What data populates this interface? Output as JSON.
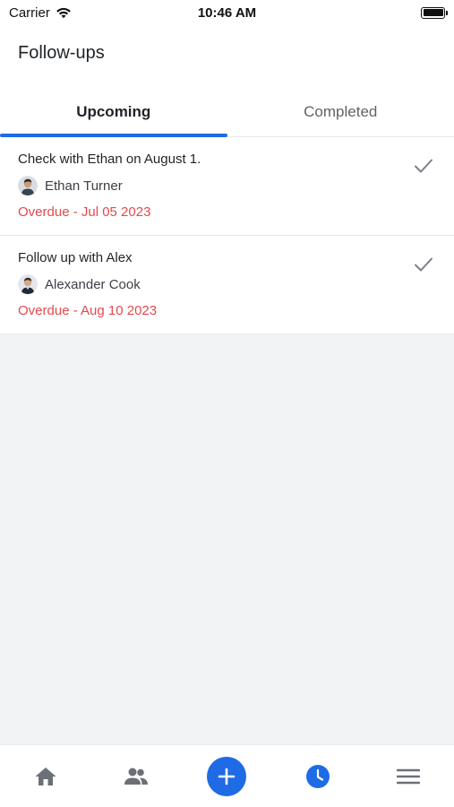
{
  "status_bar": {
    "carrier": "Carrier",
    "time": "10:46 AM"
  },
  "header": {
    "title": "Follow-ups"
  },
  "tabs": [
    {
      "label": "Upcoming",
      "active": true
    },
    {
      "label": "Completed",
      "active": false
    }
  ],
  "followups": [
    {
      "title": "Check with Ethan on August 1.",
      "person": "Ethan Turner",
      "due": "Overdue - Jul 05 2023",
      "icon": "checkmark-icon"
    },
    {
      "title": "Follow up with Alex",
      "person": "Alexander Cook",
      "due": "Overdue - Aug 10 2023",
      "icon": "checkmark-icon"
    }
  ],
  "bottom_nav": [
    {
      "icon": "home-icon"
    },
    {
      "icon": "contacts-icon"
    },
    {
      "icon": "add-icon"
    },
    {
      "icon": "clock-icon"
    },
    {
      "icon": "menu-icon"
    }
  ],
  "colors": {
    "accent": "#1f6be6",
    "overdue": "#e5484d",
    "background": "#f2f3f5"
  }
}
